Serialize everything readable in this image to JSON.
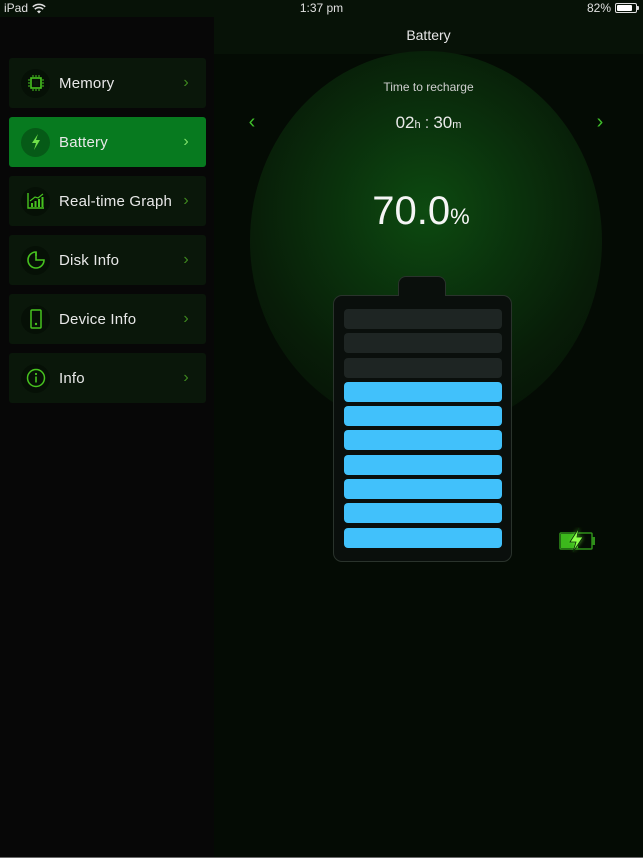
{
  "status_bar": {
    "device": "iPad",
    "time": "1:37 pm",
    "battery_percent": "82%",
    "battery_level": 0.82,
    "wifi_icon": "wifi-icon",
    "battery_icon": "battery-icon"
  },
  "sidebar": {
    "items": [
      {
        "label": "Memory",
        "icon": "chip-icon",
        "active": false
      },
      {
        "label": "Battery",
        "icon": "bolt-icon",
        "active": true
      },
      {
        "label": "Real-time Graph",
        "icon": "bar-chart-icon",
        "active": false
      },
      {
        "label": "Disk Info",
        "icon": "disk-pie-icon",
        "active": false
      },
      {
        "label": "Device Info",
        "icon": "phone-icon",
        "active": false
      },
      {
        "label": "Info",
        "icon": "info-icon",
        "active": false
      }
    ],
    "chevron": "›"
  },
  "main": {
    "title": "Battery",
    "recharge_label": "Time to recharge",
    "hours": "02",
    "hours_unit": "h",
    "separator": ":",
    "minutes": "30",
    "minutes_unit": "m",
    "prev_arrow": "‹",
    "next_arrow": "›",
    "percent_value": "70.0",
    "percent_symbol": "%",
    "battery_cells_total": 10,
    "battery_cells_filled": 7,
    "charging_status_icon": "charging-battery-icon",
    "colors": {
      "accent_green": "#077a1f",
      "cell_blue": "#41c1fb",
      "cell_empty": "#1e2523",
      "arrow_green": "#3fbf2a"
    }
  }
}
